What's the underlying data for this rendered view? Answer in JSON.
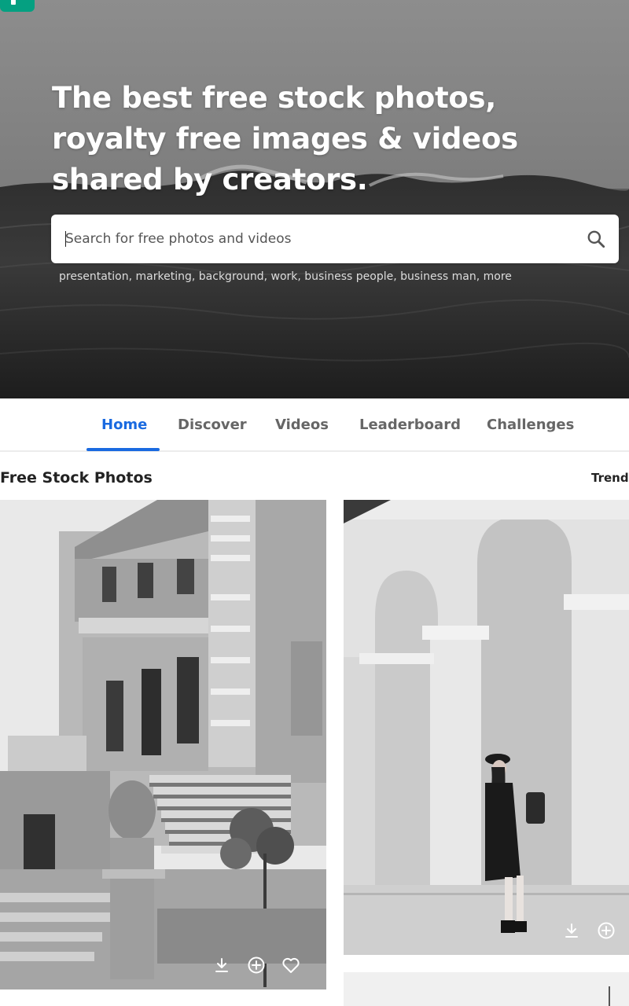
{
  "hero": {
    "headline": "The best free stock photos, royalty free images & videos shared by creators.",
    "search": {
      "placeholder": "Search for free photos and videos",
      "icon": "search-icon"
    },
    "suggestions": [
      "presentation",
      "marketing",
      "background",
      "work",
      "business people",
      "business man",
      "more"
    ]
  },
  "nav": {
    "tabs": [
      {
        "label": "Home",
        "active": true
      },
      {
        "label": "Discover",
        "active": false
      },
      {
        "label": "Videos",
        "active": false
      },
      {
        "label": "Leaderboard",
        "active": false
      },
      {
        "label": "Challenges",
        "active": false
      }
    ]
  },
  "feed": {
    "title": "Free Stock Photos",
    "sort_label": "Trendi",
    "photos": [
      {
        "subject": "black and white building with stairs",
        "actions": [
          "download-icon",
          "add-to-collection-icon",
          "like-icon"
        ]
      },
      {
        "subject": "woman standing by white arches",
        "actions": [
          "download-icon",
          "add-to-collection-icon"
        ]
      }
    ]
  },
  "colors": {
    "accent": "#1a6ae0",
    "brand": "#05a081",
    "text": "#222222",
    "tab_inactive": "#666666"
  }
}
